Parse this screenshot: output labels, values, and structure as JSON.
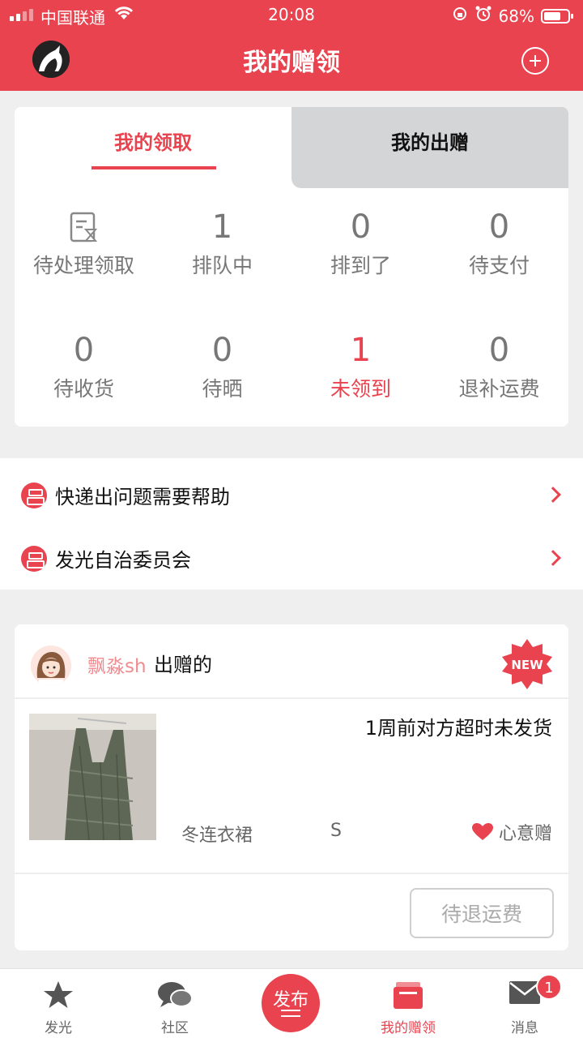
{
  "status_bar": {
    "carrier": "中国联通",
    "time": "20:08",
    "battery": "68%"
  },
  "header": {
    "title": "我的赠领"
  },
  "tabs": [
    {
      "label": "我的领取",
      "active": true
    },
    {
      "label": "我的出赠",
      "active": false
    }
  ],
  "stats": [
    {
      "label": "待处理领取",
      "value": "",
      "icon": "pending-doc-icon"
    },
    {
      "label": "排队中",
      "value": "1"
    },
    {
      "label": "排到了",
      "value": "0"
    },
    {
      "label": "待支付",
      "value": "0"
    },
    {
      "label": "待收货",
      "value": "0"
    },
    {
      "label": "待晒",
      "value": "0"
    },
    {
      "label": "未领到",
      "value": "1",
      "highlight": true
    },
    {
      "label": "退补运费",
      "value": "0"
    }
  ],
  "links": [
    {
      "label": "快递出问题需要帮助"
    },
    {
      "label": "发光自治委员会"
    }
  ],
  "order": {
    "giver_name": "飘淼sh",
    "giver_suffix": "出赠的",
    "badge": "NEW",
    "status": "1周前对方超时未发货",
    "item_name": "冬连衣裙",
    "item_size": "S",
    "gift_type": "心意赠",
    "action": "待退运费"
  },
  "bottom_nav": [
    {
      "label": "发光",
      "icon": "star-icon"
    },
    {
      "label": "社区",
      "icon": "chat-icon"
    },
    {
      "label": "发布",
      "icon": "publish-icon"
    },
    {
      "label": "我的赠领",
      "icon": "gift-box-icon",
      "active": true
    },
    {
      "label": "消息",
      "icon": "mail-icon",
      "badge": "1"
    }
  ],
  "colors": {
    "accent": "#e8434f",
    "tab_inactive_bg": "#d4d5d7",
    "muted_text": "#777777"
  }
}
